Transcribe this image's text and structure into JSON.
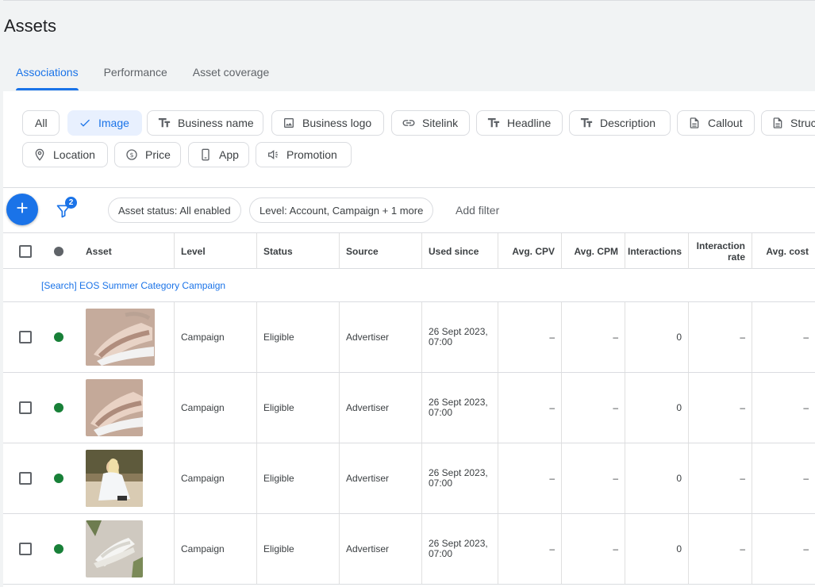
{
  "page": {
    "title": "Assets"
  },
  "tabs": [
    {
      "label": "Associations",
      "active": true
    },
    {
      "label": "Performance",
      "active": false
    },
    {
      "label": "Asset coverage",
      "active": false
    }
  ],
  "chips": [
    {
      "label": "All",
      "icon": "none",
      "selected": false
    },
    {
      "label": "Image",
      "icon": "check-icon",
      "selected": true
    },
    {
      "label": "Business name",
      "icon": "text-format-icon",
      "selected": false
    },
    {
      "label": "Business logo",
      "icon": "image-icon",
      "selected": false
    },
    {
      "label": "Sitelink",
      "icon": "link-icon",
      "selected": false
    },
    {
      "label": "Headline",
      "icon": "text-format-icon",
      "selected": false
    },
    {
      "label": "Description",
      "icon": "text-format-icon",
      "selected": false
    },
    {
      "label": "Callout",
      "icon": "document-icon",
      "selected": false
    },
    {
      "label": "Struc",
      "icon": "document-icon",
      "selected": false
    },
    {
      "label": "Location",
      "icon": "location-pin-icon",
      "selected": false
    },
    {
      "label": "Price",
      "icon": "price-icon",
      "selected": false
    },
    {
      "label": "App",
      "icon": "phone-icon",
      "selected": false
    },
    {
      "label": "Promotion",
      "icon": "megaphone-icon",
      "selected": false
    }
  ],
  "toolbar": {
    "add_icon": "plus-icon",
    "filter_icon": "filter-icon",
    "filter_count": "2",
    "filters": [
      {
        "label": "Asset status: All enabled"
      },
      {
        "label": "Level: Account, Campaign + 1 more"
      }
    ],
    "add_filter_label": "Add filter"
  },
  "table": {
    "headers": [
      "Asset",
      "Level",
      "Status",
      "Source",
      "Used since",
      "Avg. CPV",
      "Avg. CPM",
      "Interactions",
      "Interaction rate",
      "Avg. cost"
    ],
    "group_label": "[Search] EOS Summer Category Campaign",
    "status_dot_color": "#188038",
    "rows": [
      {
        "thumb": "sandal-photo-1",
        "level": "Campaign",
        "status": "Eligible",
        "source": "Advertiser",
        "used_since": "26 Sept 2023, 07:00",
        "avg_cpv": "–",
        "avg_cpm": "–",
        "interactions": "0",
        "interaction_rate": "–",
        "avg_cost": "–"
      },
      {
        "thumb": "sandal-photo-2",
        "level": "Campaign",
        "status": "Eligible",
        "source": "Advertiser",
        "used_since": "26 Sept 2023, 07:00",
        "avg_cpv": "–",
        "avg_cpm": "–",
        "interactions": "0",
        "interaction_rate": "–",
        "avg_cost": "–"
      },
      {
        "thumb": "woman-beach-photo",
        "level": "Campaign",
        "status": "Eligible",
        "source": "Advertiser",
        "used_since": "26 Sept 2023, 07:00",
        "avg_cpv": "–",
        "avg_cpm": "–",
        "interactions": "0",
        "interaction_rate": "–",
        "avg_cost": "–"
      },
      {
        "thumb": "white-sandal-photo",
        "level": "Campaign",
        "status": "Eligible",
        "source": "Advertiser",
        "used_since": "26 Sept 2023, 07:00",
        "avg_cpv": "–",
        "avg_cpm": "–",
        "interactions": "0",
        "interaction_rate": "–",
        "avg_cost": "–"
      }
    ]
  },
  "colors": {
    "accent": "#1a73e8",
    "status_green": "#188038",
    "header_gray": "#5f6368"
  }
}
